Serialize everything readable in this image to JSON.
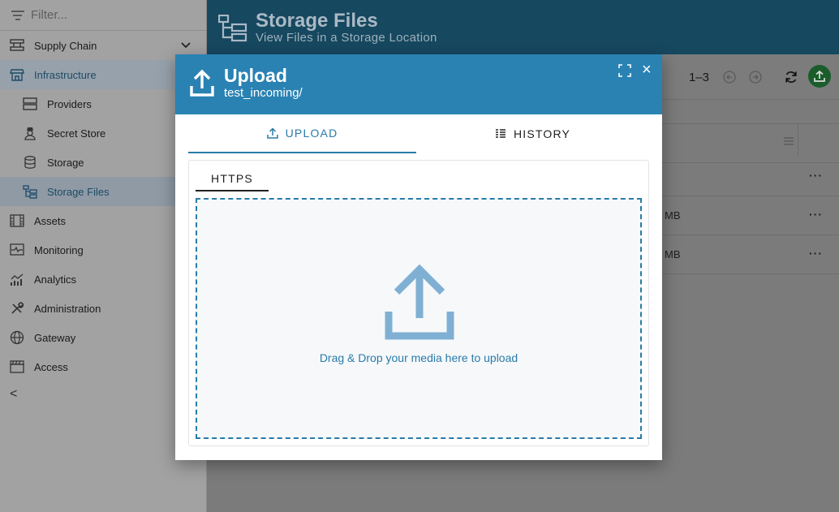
{
  "sidebar": {
    "filter_placeholder": "Filter...",
    "items": [
      {
        "label": "Supply Chain"
      },
      {
        "label": "Infrastructure"
      },
      {
        "label": "Providers"
      },
      {
        "label": "Secret Store"
      },
      {
        "label": "Storage"
      },
      {
        "label": "Storage Files"
      },
      {
        "label": "Assets"
      },
      {
        "label": "Monitoring"
      },
      {
        "label": "Analytics"
      },
      {
        "label": "Administration"
      },
      {
        "label": "Gateway"
      },
      {
        "label": "Access"
      }
    ],
    "collapse_glyph": "<"
  },
  "header": {
    "title": "Storage Files",
    "subtitle": "View Files in a Storage Location"
  },
  "toolbar": {
    "pager_text": "1–3"
  },
  "table": {
    "rows": [
      {
        "size": "",
        "actions": "···"
      },
      {
        "size": "MB",
        "actions": "···"
      },
      {
        "size": "MB",
        "actions": "···"
      }
    ]
  },
  "dialog": {
    "title": "Upload",
    "subtitle": "test_incoming/",
    "close_glyph": "×",
    "tabs": {
      "upload": "UPLOAD",
      "history": "HISTORY"
    },
    "subtab": "HTTPS",
    "dropzone_text": "Drag & Drop your media here to upload"
  },
  "colors": {
    "dialog_header": "#2a82b3",
    "accent": "#2a7ba8",
    "main_header": "#164860",
    "upload_fab": "#1a5d2b"
  }
}
